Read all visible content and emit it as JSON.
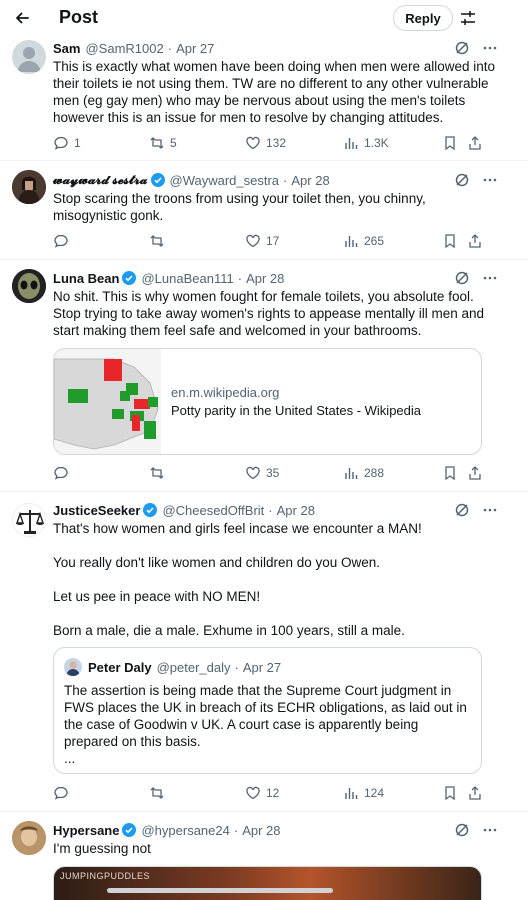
{
  "header": {
    "title": "Post",
    "reply_label": "Reply"
  },
  "icons": {
    "back": "arrow-left-icon",
    "settings": "sliders-icon",
    "more": "more-horizontal-icon",
    "grok": "grok-icon",
    "reply": "reply-bubble-icon",
    "repost": "repost-icon",
    "like": "heart-icon",
    "views": "views-bar-icon",
    "bookmark": "bookmark-icon",
    "share": "share-icon",
    "verified": "verified-badge-icon"
  },
  "colors": {
    "verified": "#1d9bf0",
    "muted": "#536471",
    "border": "#cfd9de"
  },
  "tweets": [
    {
      "name": "Sam",
      "handle": "@SamR1002",
      "dot": "·",
      "date": "Apr 27",
      "verified": false,
      "text": "This is exactly what women have been doing when men were allowed into their toilets ie not using them. TW are no different to any other vulnerable men (eg gay men) who may be nervous about using the men's toilets however this is an issue for men to resolve by changing attitudes.",
      "replies": "1",
      "reposts": "5",
      "likes": "132",
      "views": "1.3K"
    },
    {
      "name": "𝔀𝓪𝔂𝔀𝓪𝓻𝓭 𝓼𝓮𝓼𝓽𝓻𝓪",
      "handle": "@Wayward_sestra",
      "dot": "·",
      "date": "Apr 28",
      "verified": true,
      "text": "Stop scaring the troons from using your toilet then, you chinny, misogynistic gonk.",
      "replies": "",
      "reposts": "",
      "likes": "17",
      "views": "265"
    },
    {
      "name": "Luna Bean",
      "handle": "@LunaBean111",
      "dot": "·",
      "date": "Apr 28",
      "verified": true,
      "text": "No shit. This is why women fought for female toilets, you absolute fool. Stop trying to take away women's rights to appease mentally ill men and start making them feel safe and welcomed in your bathrooms.",
      "card": {
        "domain": "en.m.wikipedia.org",
        "title": "Potty parity in the United States - Wikipedia"
      },
      "replies": "",
      "reposts": "",
      "likes": "35",
      "views": "288"
    },
    {
      "name": "JusticeSeeker",
      "handle": "@CheesedOffBrit",
      "dot": "·",
      "date": "Apr 28",
      "verified": true,
      "text": "That's how women and girls feel incase we encounter a MAN!\n\nYou really don't like women and children do you Owen.\n\nLet us pee in peace with NO MEN!\n\nBorn a male, die a male. Exhume in 100 years, still a male.",
      "quote": {
        "name": "Peter Daly",
        "handle": "@peter_daly",
        "dot": "·",
        "date": "Apr 27",
        "text": "The assertion is being made that the Supreme Court judgment in FWS places the UK in breach of its ECHR obligations, as laid out in the case of Goodwin v UK. A court case is apparently being prepared on this basis.\n..."
      },
      "replies": "",
      "reposts": "",
      "likes": "12",
      "views": "124"
    },
    {
      "name": "Hypersane",
      "handle": "@hypersane24",
      "dot": "·",
      "date": "Apr 28",
      "verified": true,
      "text": "I'm guessing not",
      "media_watermark": "JUMPINGPUDDLES"
    }
  ]
}
